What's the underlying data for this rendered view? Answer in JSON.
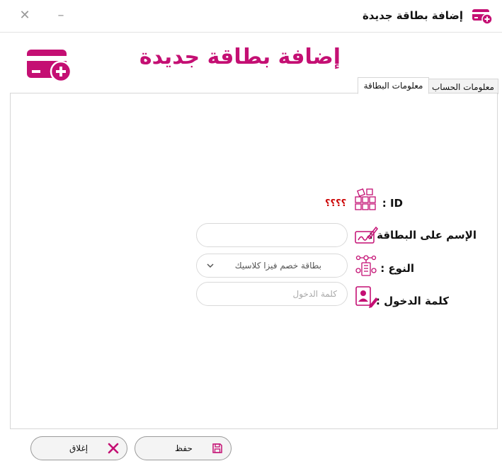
{
  "window": {
    "title": "إضافة بطاقة جديدة",
    "minimize_glyph": "–",
    "close_glyph": "✕"
  },
  "header": {
    "title": "إضافة بطاقة جديدة",
    "icon": "card-remove-add-icon",
    "accent_color": "#c40f73"
  },
  "tabs": [
    {
      "label": "معلومات البطاقة",
      "selected": true
    },
    {
      "label": "معلومات الحساب",
      "selected": false
    }
  ],
  "form": {
    "id_label": "ID :",
    "id_value": "؟؟؟؟",
    "name_label": "الإسم على البطاقة :",
    "name_value": "",
    "type_label": "النوع :",
    "type_value": "بطاقة خصم فيزا كلاسيك",
    "password_label": "كلمة الدخول :",
    "password_placeholder": "كلمة الدخول"
  },
  "buttons": {
    "save_label": "حفظ",
    "close_label": "إغلاق"
  }
}
